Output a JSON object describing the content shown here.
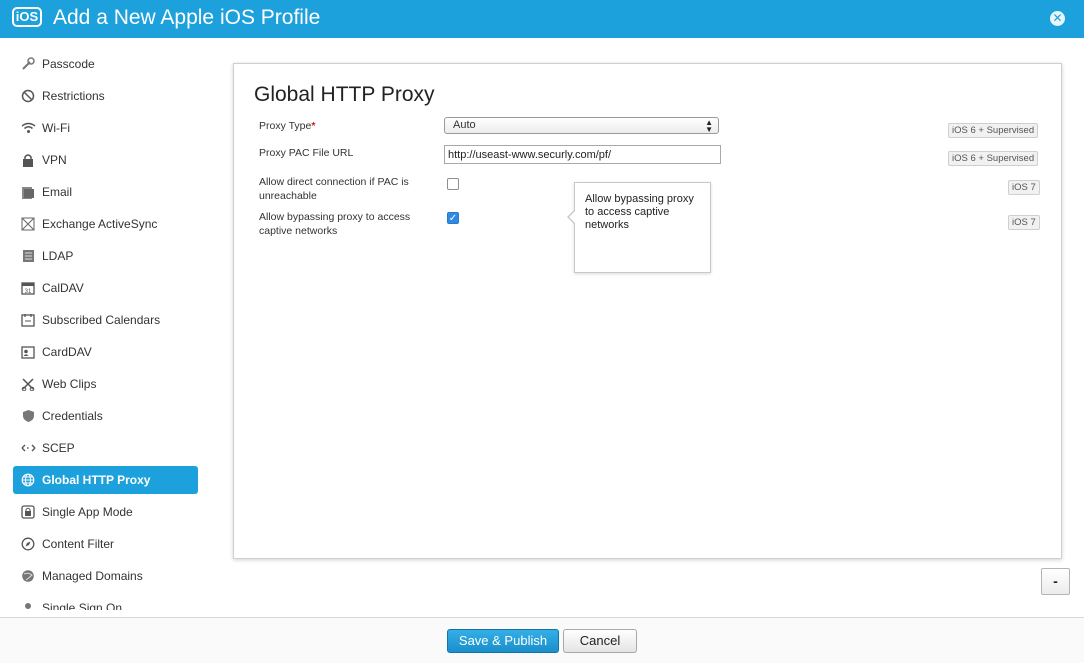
{
  "header": {
    "badge": "iOS",
    "title": "Add a New Apple iOS Profile",
    "close_icon": "close-icon"
  },
  "sidebar": {
    "items": [
      {
        "label": "Passcode",
        "icon": "passcode-icon"
      },
      {
        "label": "Restrictions",
        "icon": "restrictions-icon"
      },
      {
        "label": "Wi-Fi",
        "icon": "wifi-icon"
      },
      {
        "label": "VPN",
        "icon": "lock-icon"
      },
      {
        "label": "Email",
        "icon": "email-icon"
      },
      {
        "label": "Exchange ActiveSync",
        "icon": "exchange-icon"
      },
      {
        "label": "LDAP",
        "icon": "ldap-icon"
      },
      {
        "label": "CalDAV",
        "icon": "calendar-icon"
      },
      {
        "label": "Subscribed Calendars",
        "icon": "subscribed-calendar-icon"
      },
      {
        "label": "CardDAV",
        "icon": "contact-card-icon"
      },
      {
        "label": "Web Clips",
        "icon": "web-clips-icon"
      },
      {
        "label": "Credentials",
        "icon": "shield-icon"
      },
      {
        "label": "SCEP",
        "icon": "scep-icon"
      },
      {
        "label": "Global HTTP Proxy",
        "icon": "globe-icon",
        "active": true
      },
      {
        "label": "Single App Mode",
        "icon": "single-app-icon"
      },
      {
        "label": "Content Filter",
        "icon": "compass-icon"
      },
      {
        "label": "Managed Domains",
        "icon": "managed-domains-icon"
      },
      {
        "label": "Single Sign On",
        "icon": "single-sign-on-icon"
      }
    ]
  },
  "panel": {
    "title": "Global HTTP Proxy",
    "rows": {
      "proxy_type": {
        "label": "Proxy Type",
        "required_mark": "*",
        "value": "Auto",
        "badge": "iOS 6 + Supervised"
      },
      "pac_url": {
        "label": "Proxy PAC File URL",
        "value": "http://useast-www.securly.com/pf/",
        "badge": "iOS 6 + Supervised"
      },
      "allow_direct": {
        "label_line1": "Allow direct connection if PAC is",
        "label_line2": "unreachable",
        "checked": false,
        "badge": "iOS 7"
      },
      "allow_bypass": {
        "label_line1": "Allow bypassing proxy to access",
        "label_line2": "captive networks",
        "checked": true,
        "badge": "iOS 7"
      }
    },
    "tooltip": {
      "line1": "Allow bypassing proxy",
      "line2": "to access captive",
      "line3": "networks"
    }
  },
  "collapse_button": {
    "label": "-"
  },
  "footer": {
    "save_label": "Save & Publish",
    "cancel_label": "Cancel"
  },
  "colors": {
    "accent": "#1da1dc",
    "required": "#d01c1c"
  }
}
